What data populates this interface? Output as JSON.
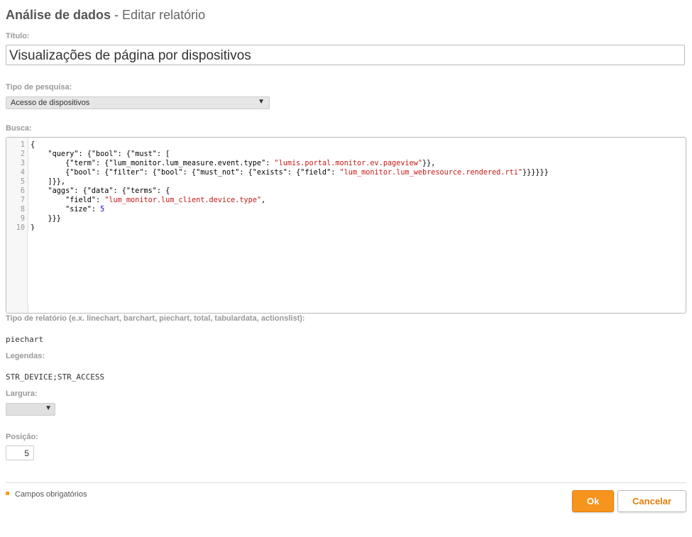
{
  "header": {
    "app": "Análise de dados",
    "separator": " - ",
    "page": "Editar relatório"
  },
  "form": {
    "title_label": "Título:",
    "title_value": "Visualizações de página por dispositivos",
    "search_type_label": "Tipo de pesquisa:",
    "search_type_value": "Acesso de dispositivos",
    "query_label": "Busca:",
    "query_lines": [
      {
        "n": "1",
        "text": "{"
      },
      {
        "n": "2",
        "text": "    \"query\": {\"bool\": {\"must\": ["
      },
      {
        "n": "3",
        "pre": "        {\"term\": {\"lum_monitor.lum_measure.event.type\": ",
        "str": "\"lumis.portal.monitor.ev.pageview\"",
        "post": "}},"
      },
      {
        "n": "4",
        "pre": "        {\"bool\": {\"filter\": {\"bool\": {\"must_not\": {\"exists\": {\"field\": ",
        "str": "\"lum_monitor.lum_webresource.rendered.rti\"",
        "post": "}}}}}}"
      },
      {
        "n": "5",
        "text": "    ]}},"
      },
      {
        "n": "6",
        "text": "    \"aggs\": {\"data\": {\"terms\": {"
      },
      {
        "n": "7",
        "pre": "        \"field\": ",
        "str": "\"lum_monitor.lum_client.device.type\"",
        "post": ","
      },
      {
        "n": "8",
        "pre": "        \"size\": ",
        "num": "5",
        "post": ""
      },
      {
        "n": "9",
        "text": "    }}}"
      },
      {
        "n": "10",
        "text": "}"
      }
    ],
    "report_type_label": "Tipo de relatório (e.x. linechart, barchart, piechart, total, tabulardata, actionslist):",
    "report_type_value": "piechart",
    "legends_label": "Legendas:",
    "legends_value": "STR_DEVICE;STR_ACCESS",
    "width_label": "Largura:",
    "width_value": "",
    "position_label": "Posição:",
    "position_value": "5"
  },
  "footer": {
    "required_text": "Campos obrigatórios",
    "ok_label": "Ok",
    "cancel_label": "Cancelar"
  },
  "colors": {
    "accent": "#f7941d",
    "string": "#c41a16",
    "number": "#1c00cf"
  },
  "icons": {
    "select_arrow": "chevron-down-icon",
    "required": "required-marker-icon"
  }
}
